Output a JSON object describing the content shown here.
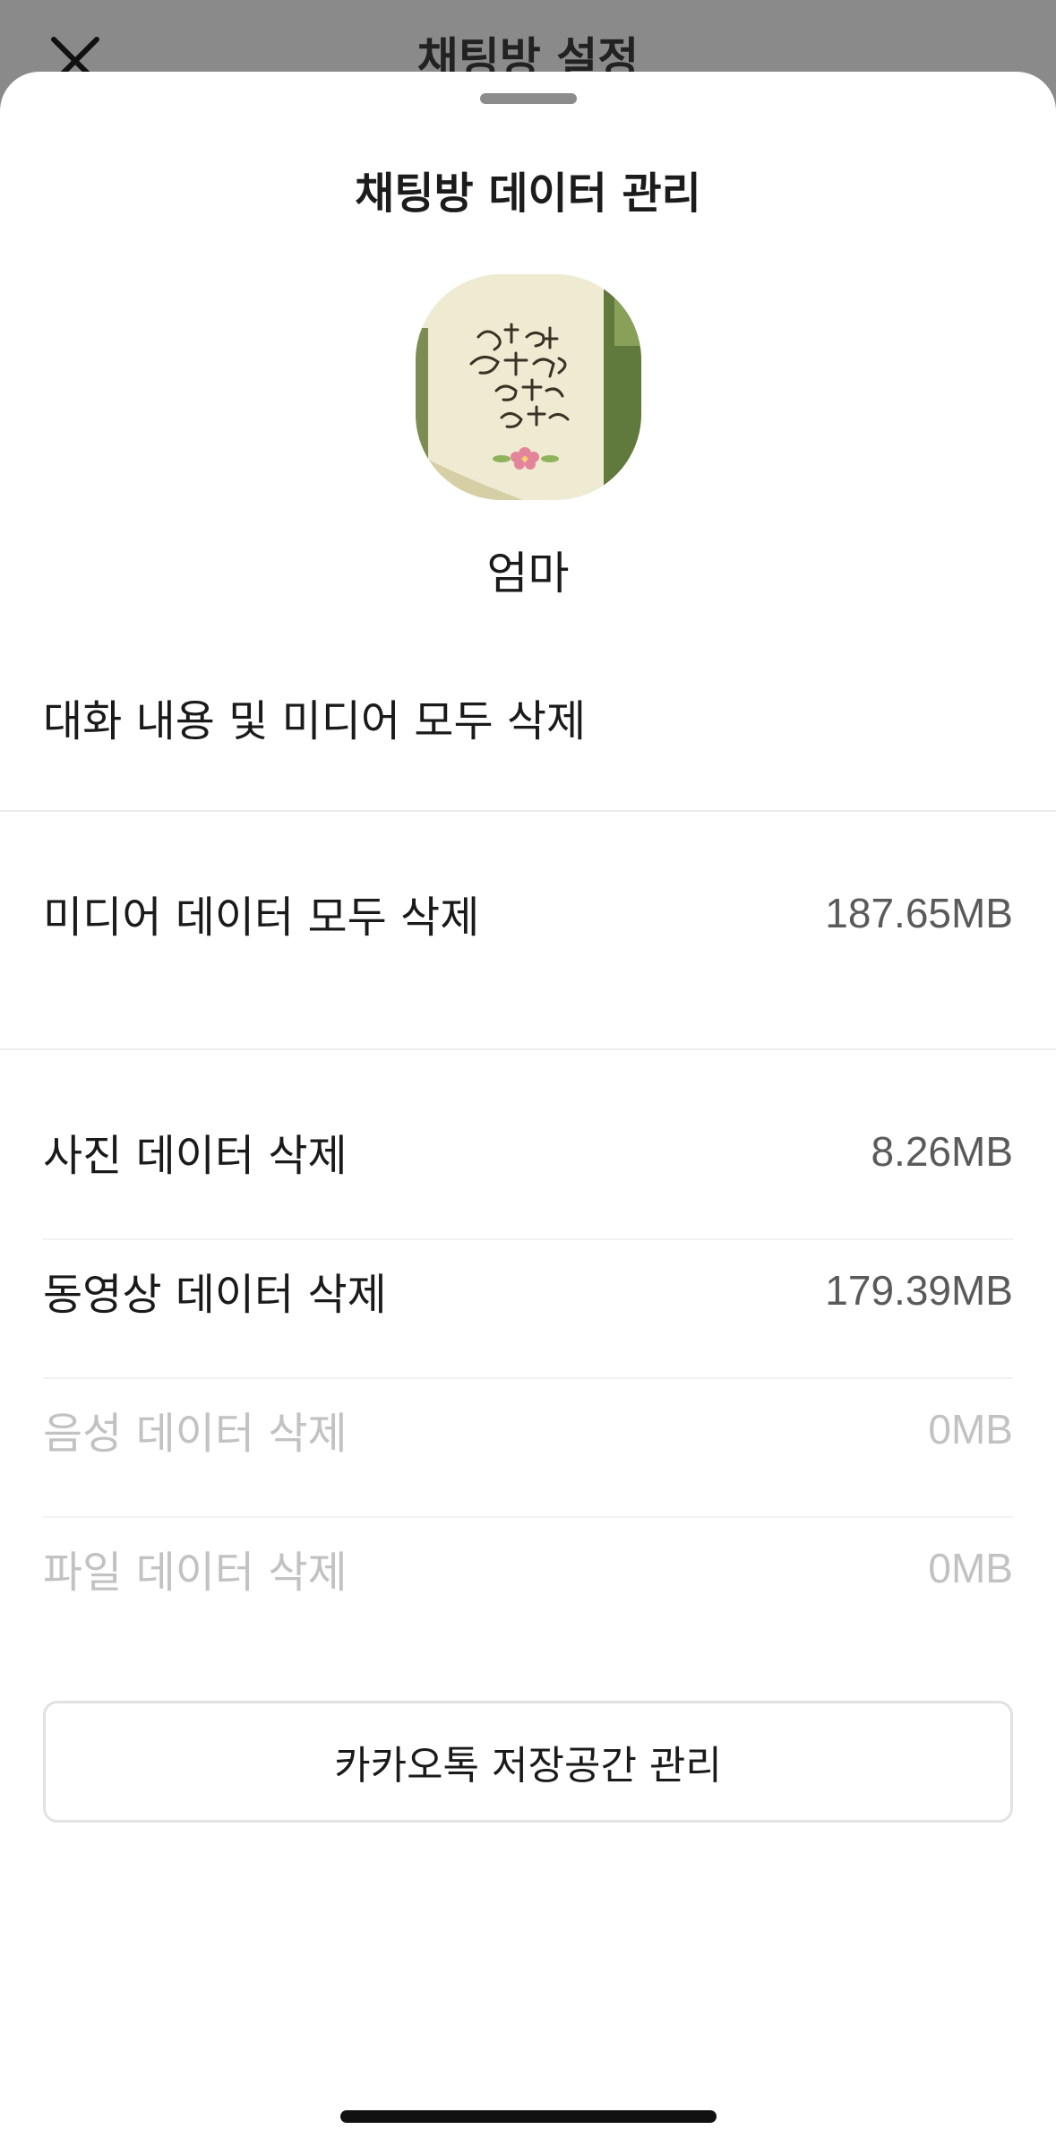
{
  "backdrop": {
    "title": "채팅방 설정",
    "close_icon": "close-icon"
  },
  "sheet": {
    "title": "채팅방 데이터 관리",
    "profile": {
      "name": "엄마",
      "avatar_icon": "profile-photo"
    },
    "delete_all": {
      "label": "대화 내용 및 미디어 모두 삭제"
    },
    "delete_media": {
      "label": "미디어 데이터 모두 삭제",
      "size": "187.65MB"
    },
    "items": [
      {
        "label": "사진 데이터 삭제",
        "size": "8.26MB",
        "enabled": true
      },
      {
        "label": "동영상 데이터 삭제",
        "size": "179.39MB",
        "enabled": true
      },
      {
        "label": "음성 데이터 삭제",
        "size": "0MB",
        "enabled": false
      },
      {
        "label": "파일 데이터 삭제",
        "size": "0MB",
        "enabled": false
      }
    ],
    "storage_button": "카카오톡 저장공간 관리"
  },
  "colors": {
    "backdrop": "#8a8a8a",
    "sheet": "#ffffff",
    "disabled_text": "#c2c2c2",
    "value_text": "#5a5a5a"
  }
}
